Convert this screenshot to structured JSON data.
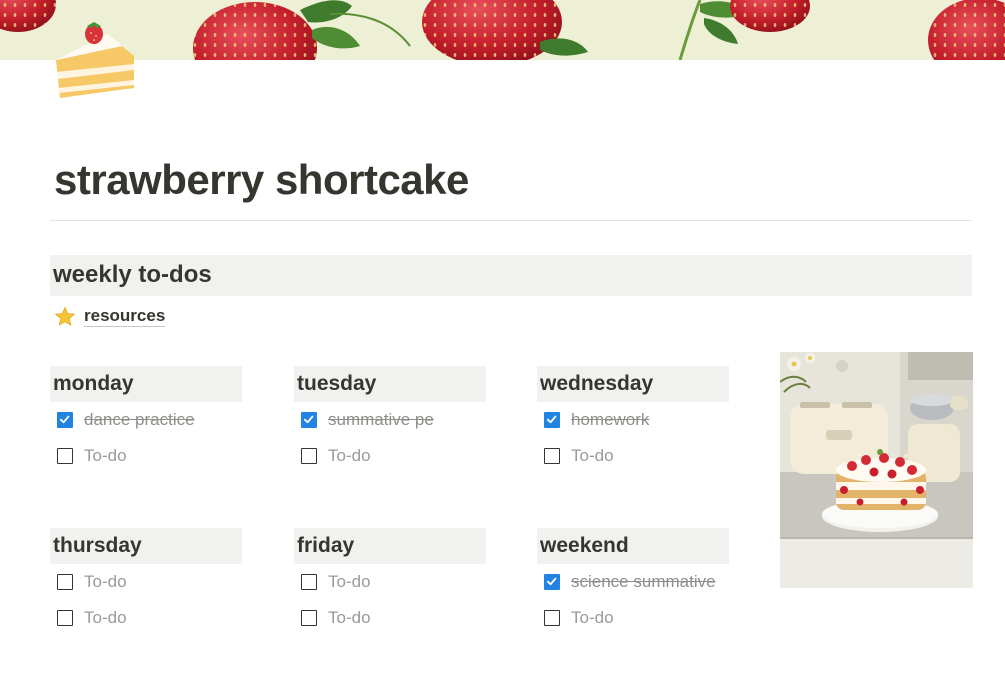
{
  "page": {
    "title": "strawberry shortcake",
    "icon": "shortcake-icon",
    "cover": "strawberry-pattern-cover"
  },
  "section": {
    "title": "weekly to-dos"
  },
  "resources_link": {
    "icon": "star-icon",
    "label": "resources"
  },
  "days": [
    {
      "name": "monday",
      "todos": [
        {
          "text": "dance practice",
          "checked": true
        },
        {
          "text": "To-do",
          "checked": false
        }
      ]
    },
    {
      "name": "tuesday",
      "todos": [
        {
          "text": "summative pe",
          "checked": true
        },
        {
          "text": "To-do",
          "checked": false
        }
      ]
    },
    {
      "name": "wednesday",
      "todos": [
        {
          "text": "homework",
          "checked": true
        },
        {
          "text": "To-do",
          "checked": false
        }
      ]
    },
    {
      "name": "thursday",
      "todos": [
        {
          "text": "To-do",
          "checked": false
        },
        {
          "text": "To-do",
          "checked": false
        }
      ]
    },
    {
      "name": "friday",
      "todos": [
        {
          "text": "To-do",
          "checked": false
        },
        {
          "text": "To-do",
          "checked": false
        }
      ]
    },
    {
      "name": "weekend",
      "todos": [
        {
          "text": "science summative",
          "checked": true
        },
        {
          "text": "To-do",
          "checked": false
        }
      ]
    }
  ],
  "colors": {
    "checkbox_checked": "#2383e2",
    "header_bg": "#f1f1ef",
    "text": "#37352f",
    "muted_text": "#9b9a97"
  }
}
